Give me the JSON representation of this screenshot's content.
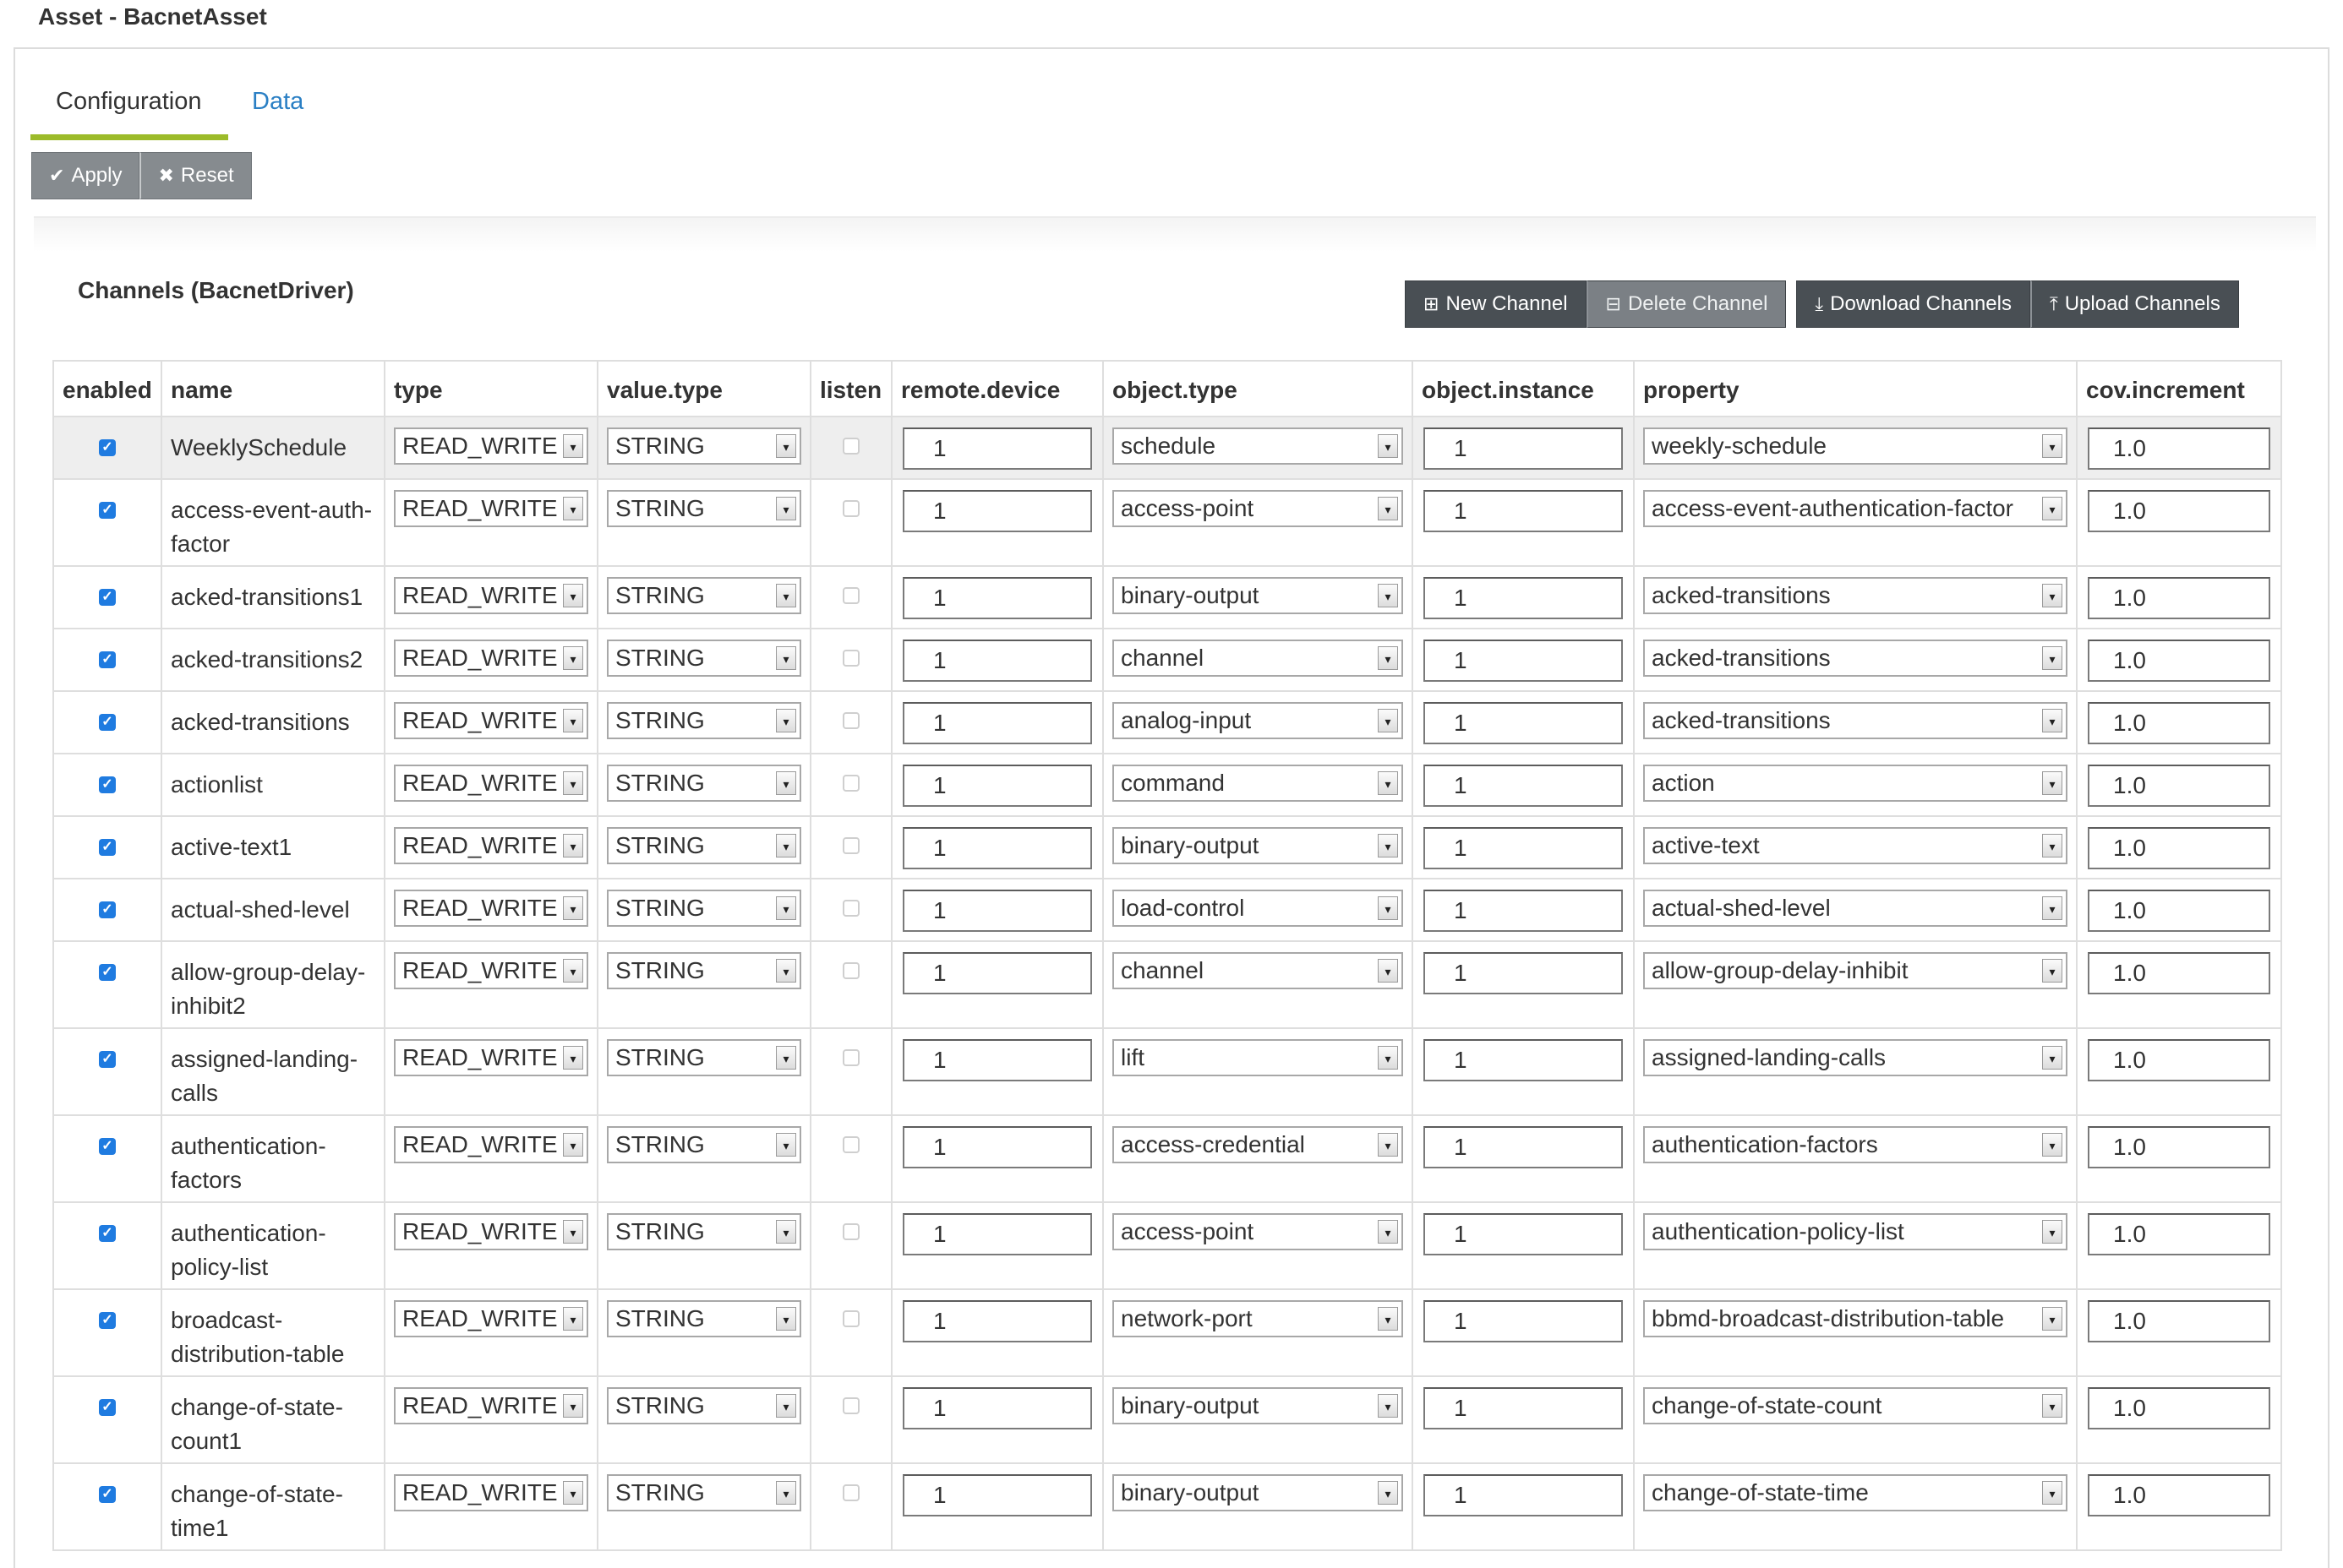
{
  "page": {
    "title": "Asset - BacnetAsset"
  },
  "tabs": [
    {
      "label": "Configuration"
    },
    {
      "label": "Data"
    }
  ],
  "toolbar": {
    "apply_label": "Apply",
    "reset_label": "Reset"
  },
  "section": {
    "title": "Channels (BacnetDriver)",
    "new_channel": "New Channel",
    "delete_channel": "Delete Channel",
    "download_channels": "Download Channels",
    "upload_channels": "Upload Channels"
  },
  "table": {
    "headers": [
      "enabled",
      "name",
      "type",
      "value.type",
      "listen",
      "remote.device",
      "object.type",
      "object.instance",
      "property",
      "cov.increment"
    ],
    "rows": [
      {
        "enabled": true,
        "name": "WeeklySchedule",
        "type": "READ_WRITE",
        "value_type": "STRING",
        "listen": false,
        "remote_device": "1",
        "object_type": "schedule",
        "object_instance": "1",
        "property": "weekly-schedule",
        "cov_increment": "1.0"
      },
      {
        "enabled": true,
        "name": "access-event-auth-factor",
        "type": "READ_WRITE",
        "value_type": "STRING",
        "listen": false,
        "remote_device": "1",
        "object_type": "access-point",
        "object_instance": "1",
        "property": "access-event-authentication-factor",
        "cov_increment": "1.0"
      },
      {
        "enabled": true,
        "name": "acked-transitions1",
        "type": "READ_WRITE",
        "value_type": "STRING",
        "listen": false,
        "remote_device": "1",
        "object_type": "binary-output",
        "object_instance": "1",
        "property": "acked-transitions",
        "cov_increment": "1.0"
      },
      {
        "enabled": true,
        "name": "acked-transitions2",
        "type": "READ_WRITE",
        "value_type": "STRING",
        "listen": false,
        "remote_device": "1",
        "object_type": "channel",
        "object_instance": "1",
        "property": "acked-transitions",
        "cov_increment": "1.0"
      },
      {
        "enabled": true,
        "name": "acked-transitions",
        "type": "READ_WRITE",
        "value_type": "STRING",
        "listen": false,
        "remote_device": "1",
        "object_type": "analog-input",
        "object_instance": "1",
        "property": "acked-transitions",
        "cov_increment": "1.0"
      },
      {
        "enabled": true,
        "name": "actionlist",
        "type": "READ_WRITE",
        "value_type": "STRING",
        "listen": false,
        "remote_device": "1",
        "object_type": "command",
        "object_instance": "1",
        "property": "action",
        "cov_increment": "1.0"
      },
      {
        "enabled": true,
        "name": "active-text1",
        "type": "READ_WRITE",
        "value_type": "STRING",
        "listen": false,
        "remote_device": "1",
        "object_type": "binary-output",
        "object_instance": "1",
        "property": "active-text",
        "cov_increment": "1.0"
      },
      {
        "enabled": true,
        "name": "actual-shed-level",
        "type": "READ_WRITE",
        "value_type": "STRING",
        "listen": false,
        "remote_device": "1",
        "object_type": "load-control",
        "object_instance": "1",
        "property": "actual-shed-level",
        "cov_increment": "1.0"
      },
      {
        "enabled": true,
        "name": "allow-group-delay-inhibit2",
        "type": "READ_WRITE",
        "value_type": "STRING",
        "listen": false,
        "remote_device": "1",
        "object_type": "channel",
        "object_instance": "1",
        "property": "allow-group-delay-inhibit",
        "cov_increment": "1.0"
      },
      {
        "enabled": true,
        "name": "assigned-landing-calls",
        "type": "READ_WRITE",
        "value_type": "STRING",
        "listen": false,
        "remote_device": "1",
        "object_type": "lift",
        "object_instance": "1",
        "property": "assigned-landing-calls",
        "cov_increment": "1.0"
      },
      {
        "enabled": true,
        "name": "authentication-factors",
        "type": "READ_WRITE",
        "value_type": "STRING",
        "listen": false,
        "remote_device": "1",
        "object_type": "access-credential",
        "object_instance": "1",
        "property": "authentication-factors",
        "cov_increment": "1.0"
      },
      {
        "enabled": true,
        "name": "authentication-policy-list",
        "type": "READ_WRITE",
        "value_type": "STRING",
        "listen": false,
        "remote_device": "1",
        "object_type": "access-point",
        "object_instance": "1",
        "property": "authentication-policy-list",
        "cov_increment": "1.0"
      },
      {
        "enabled": true,
        "name": "broadcast-distribution-table",
        "type": "READ_WRITE",
        "value_type": "STRING",
        "listen": false,
        "remote_device": "1",
        "object_type": "network-port",
        "object_instance": "1",
        "property": "bbmd-broadcast-distribution-table",
        "cov_increment": "1.0"
      },
      {
        "enabled": true,
        "name": "change-of-state-count1",
        "type": "READ_WRITE",
        "value_type": "STRING",
        "listen": false,
        "remote_device": "1",
        "object_type": "binary-output",
        "object_instance": "1",
        "property": "change-of-state-count",
        "cov_increment": "1.0"
      },
      {
        "enabled": true,
        "name": "change-of-state-time1",
        "type": "READ_WRITE",
        "value_type": "STRING",
        "listen": false,
        "remote_device": "1",
        "object_type": "binary-output",
        "object_instance": "1",
        "property": "change-of-state-time",
        "cov_increment": "1.0"
      }
    ]
  },
  "colors": {
    "tab_accent": "#9cbb2a",
    "link": "#2a7fc4",
    "checkbox": "#1f7be0"
  }
}
